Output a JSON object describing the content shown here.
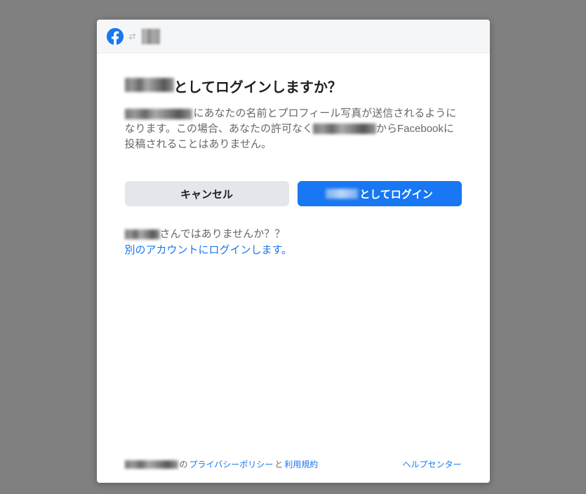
{
  "header": {
    "logo_name": "facebook-logo",
    "arrow_name": "arrow-icon"
  },
  "title": {
    "suffix": "としてログインしますか？"
  },
  "description": {
    "part1": "にあなたの名前とプロフィール写真が送信されるようになります。この場合、あなたの許可なく",
    "part2": "からFacebookに投稿されることはありません。"
  },
  "buttons": {
    "cancel": "キャンセル",
    "login_suffix": "としてログイン"
  },
  "notyou": {
    "suffix": "さんではありませんか？？",
    "link": "別のアカウントにログインします。"
  },
  "footer": {
    "of": "の",
    "privacy": "プライバシーポリシー",
    "and": "と",
    "terms": "利用規約",
    "help": "ヘルプセンター"
  }
}
